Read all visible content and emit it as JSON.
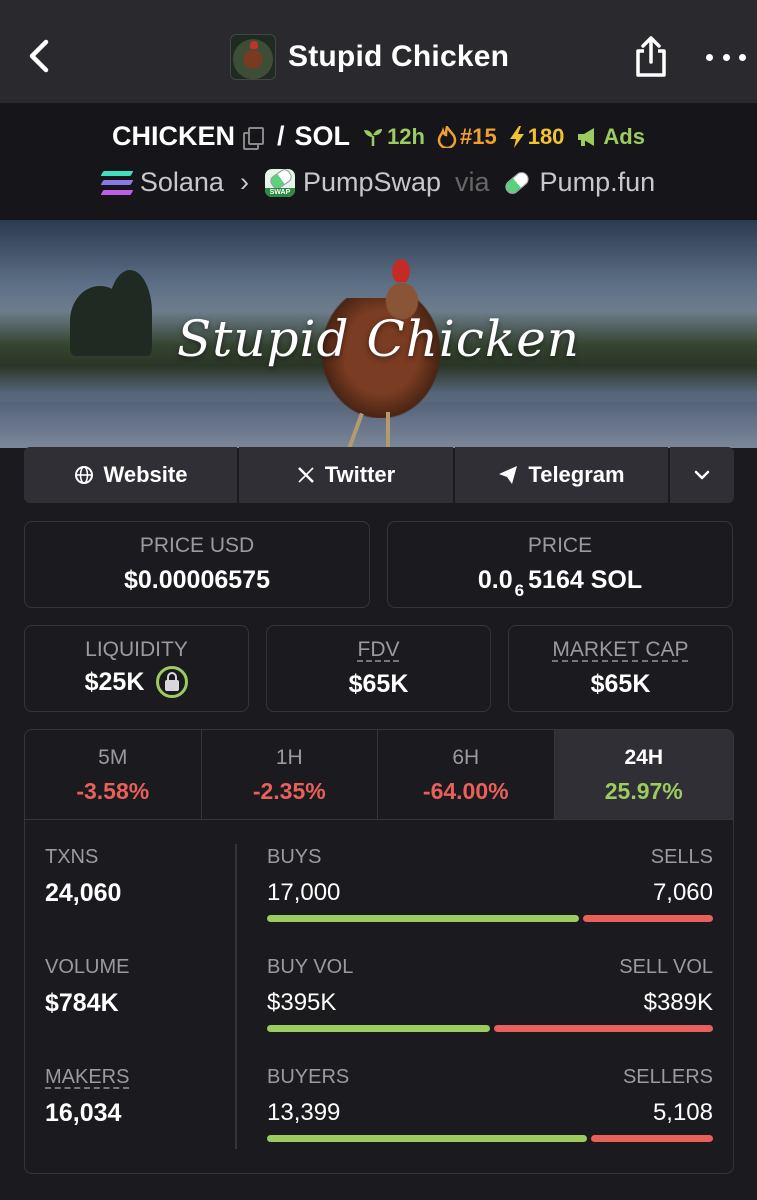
{
  "nav": {
    "title": "Stupid Chicken",
    "back_icon": "chevron-left-icon",
    "share_icon": "share-icon",
    "more_icon": "more-icon"
  },
  "pair": {
    "base": "CHICKEN",
    "separator": "/",
    "quote": "SOL",
    "age": "12h",
    "rank": "#15",
    "boosts": "180",
    "ads": "Ads",
    "chain": "Solana",
    "dex": "PumpSwap",
    "dex_logo_text": "SWAP",
    "via": "via",
    "launchpad": "Pump.fun"
  },
  "banner": {
    "title": "Stupid Chicken"
  },
  "links": {
    "website": "Website",
    "twitter": "Twitter",
    "telegram": "Telegram"
  },
  "prices": {
    "usd_label": "PRICE USD",
    "usd_value": "$0.00006575",
    "native_label": "PRICE",
    "native_prefix": "0.0",
    "native_zeros": "6",
    "native_digits": "5164 SOL"
  },
  "metrics": {
    "liquidity_label": "LIQUIDITY",
    "liquidity_value": "$25K",
    "fdv_label": "FDV",
    "fdv_value": "$65K",
    "mcap_label": "MARKET CAP",
    "mcap_value": "$65K"
  },
  "timeframes": [
    {
      "label": "5M",
      "change": "-3.58%"
    },
    {
      "label": "1H",
      "change": "-2.35%"
    },
    {
      "label": "6H",
      "change": "-64.00%"
    },
    {
      "label": "24H",
      "change": "25.97%"
    }
  ],
  "stats": {
    "txns_label": "TXNS",
    "txns_value": "24,060",
    "volume_label": "VOLUME",
    "volume_value": "$784K",
    "makers_label": "MAKERS",
    "makers_value": "16,034",
    "buys_label": "BUYS",
    "buys_value": "17,000",
    "sells_label": "SELLS",
    "sells_value": "7,060",
    "buy_vol_label": "BUY VOL",
    "buy_vol_value": "$395K",
    "sell_vol_label": "SELL VOL",
    "sell_vol_value": "$389K",
    "buyers_label": "BUYERS",
    "buyers_value": "13,399",
    "sellers_label": "SELLERS",
    "sellers_value": "5,108",
    "buys_ratio": 0.7066,
    "buy_vol_ratio": 0.5038,
    "buyers_ratio": 0.724
  },
  "colors": {
    "positive": "#9ccb5f",
    "negative": "#e8605a",
    "background": "#1a1a1f"
  }
}
